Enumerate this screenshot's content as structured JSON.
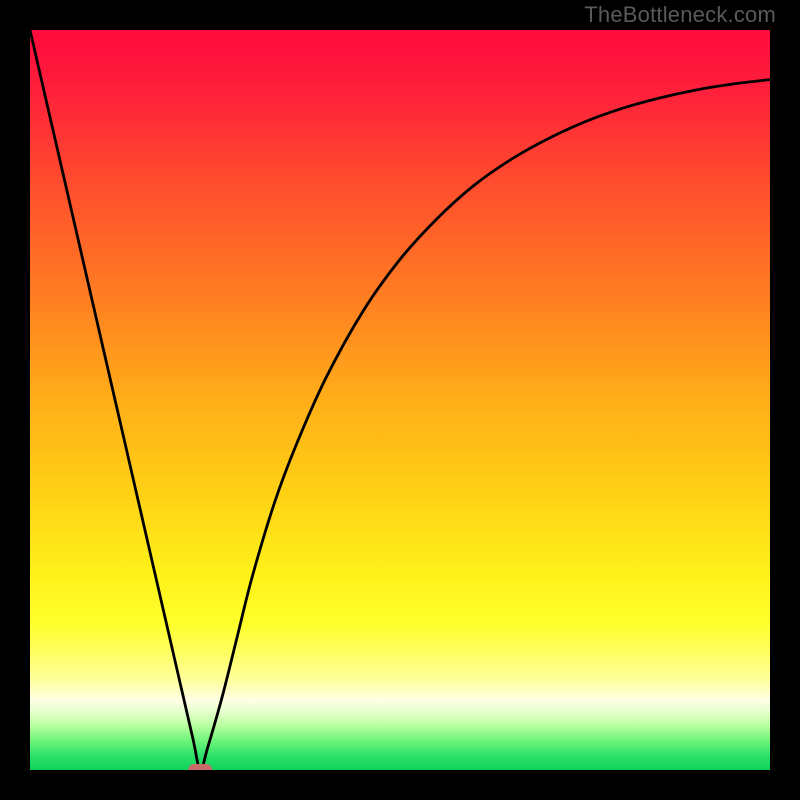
{
  "watermark": {
    "text": "TheBottleneck.com"
  },
  "chart_data": {
    "type": "line",
    "title": "",
    "xlabel": "",
    "ylabel": "",
    "xlim": [
      0,
      100
    ],
    "ylim": [
      0,
      100
    ],
    "series": [
      {
        "name": "bottleneck-curve",
        "x": [
          0,
          2,
          4,
          6,
          8,
          10,
          12,
          14,
          16,
          18,
          20,
          22,
          23,
          24,
          26,
          28,
          30,
          33,
          36,
          40,
          45,
          50,
          55,
          60,
          65,
          70,
          75,
          80,
          85,
          90,
          95,
          100
        ],
        "y": [
          100,
          91.3,
          82.6,
          73.9,
          65.2,
          56.5,
          47.8,
          39.1,
          30.4,
          21.7,
          13.0,
          4.3,
          0,
          3,
          10,
          18,
          26,
          36,
          44,
          53,
          62,
          69,
          74.5,
          79,
          82.5,
          85.3,
          87.6,
          89.4,
          90.8,
          91.9,
          92.7,
          93.3
        ]
      }
    ],
    "marker": {
      "name": "optimal-point",
      "x": 23,
      "y": 0,
      "shape": "pill",
      "color": "#c66a6a"
    },
    "gradient": {
      "stops": [
        {
          "offset": 0.0,
          "color": "#ff0a3c"
        },
        {
          "offset": 0.08,
          "color": "#ff1f3b"
        },
        {
          "offset": 0.2,
          "color": "#ff4a2e"
        },
        {
          "offset": 0.35,
          "color": "#ff7a22"
        },
        {
          "offset": 0.5,
          "color": "#ffae18"
        },
        {
          "offset": 0.63,
          "color": "#ffd215"
        },
        {
          "offset": 0.73,
          "color": "#fff01a"
        },
        {
          "offset": 0.8,
          "color": "#ffff2a"
        },
        {
          "offset": 0.84,
          "color": "#ffff60"
        },
        {
          "offset": 0.88,
          "color": "#ffffa0"
        },
        {
          "offset": 0.905,
          "color": "#ffffe6"
        },
        {
          "offset": 0.92,
          "color": "#e8ffd0"
        },
        {
          "offset": 0.94,
          "color": "#b8ffa0"
        },
        {
          "offset": 0.96,
          "color": "#70f57a"
        },
        {
          "offset": 0.98,
          "color": "#2ee26a"
        },
        {
          "offset": 1.0,
          "color": "#0fd25b"
        }
      ]
    }
  }
}
